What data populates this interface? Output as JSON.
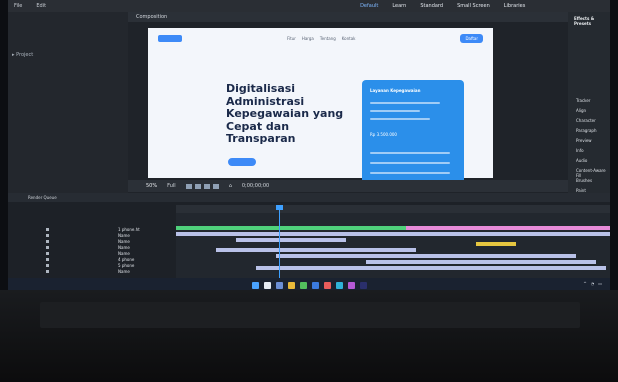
{
  "menubar": {
    "workspace_tabs": [
      "Default",
      "Learn",
      "Standard",
      "Small Screen",
      "Libraries"
    ],
    "active_tab": "Default"
  },
  "composition": {
    "tab_label": "Composition"
  },
  "website_preview": {
    "nav_items": [
      "Fitur",
      "Harga",
      "Tentang",
      "Kontak"
    ],
    "nav_button": "Daftar",
    "hero_title": "Digitalisasi Administrasi Kepegawaian yang Cepat dan Transparan",
    "card_title": "Layanan Kepegawaian",
    "card_amount": "Rp 3.500.000"
  },
  "viewer_footer": {
    "zoom": "50%",
    "resolution": "Full",
    "timecode": "0;00;00;00"
  },
  "right_panel": {
    "title": "Effects & Presets",
    "items": [
      "Tracker",
      "Align",
      "Character",
      "Paragraph",
      "Preview",
      "Info",
      "Audio",
      "Content-Aware Fill",
      "Brushes",
      "Paint"
    ]
  },
  "timeline": {
    "tab_label": "Render Queue",
    "layers": [
      "1 phone.ht",
      "Name",
      "Name",
      "Name",
      "Name",
      "4 phone",
      "5 phone",
      "Name"
    ]
  },
  "colors": {
    "accent": "#3d8af7",
    "playhead": "#3ea0ff",
    "bar_green": "#4fd17b",
    "bar_pink": "#e68ad8",
    "bar_lavender": "#b9c1e8",
    "bar_yellow": "#e6c640"
  },
  "taskbar_icons": [
    "start-icon",
    "search-icon",
    "settings-icon",
    "file-explorer-icon",
    "chrome-icon",
    "store-icon",
    "mail-icon",
    "edge-icon",
    "photos-icon",
    "aftereffects-icon"
  ]
}
